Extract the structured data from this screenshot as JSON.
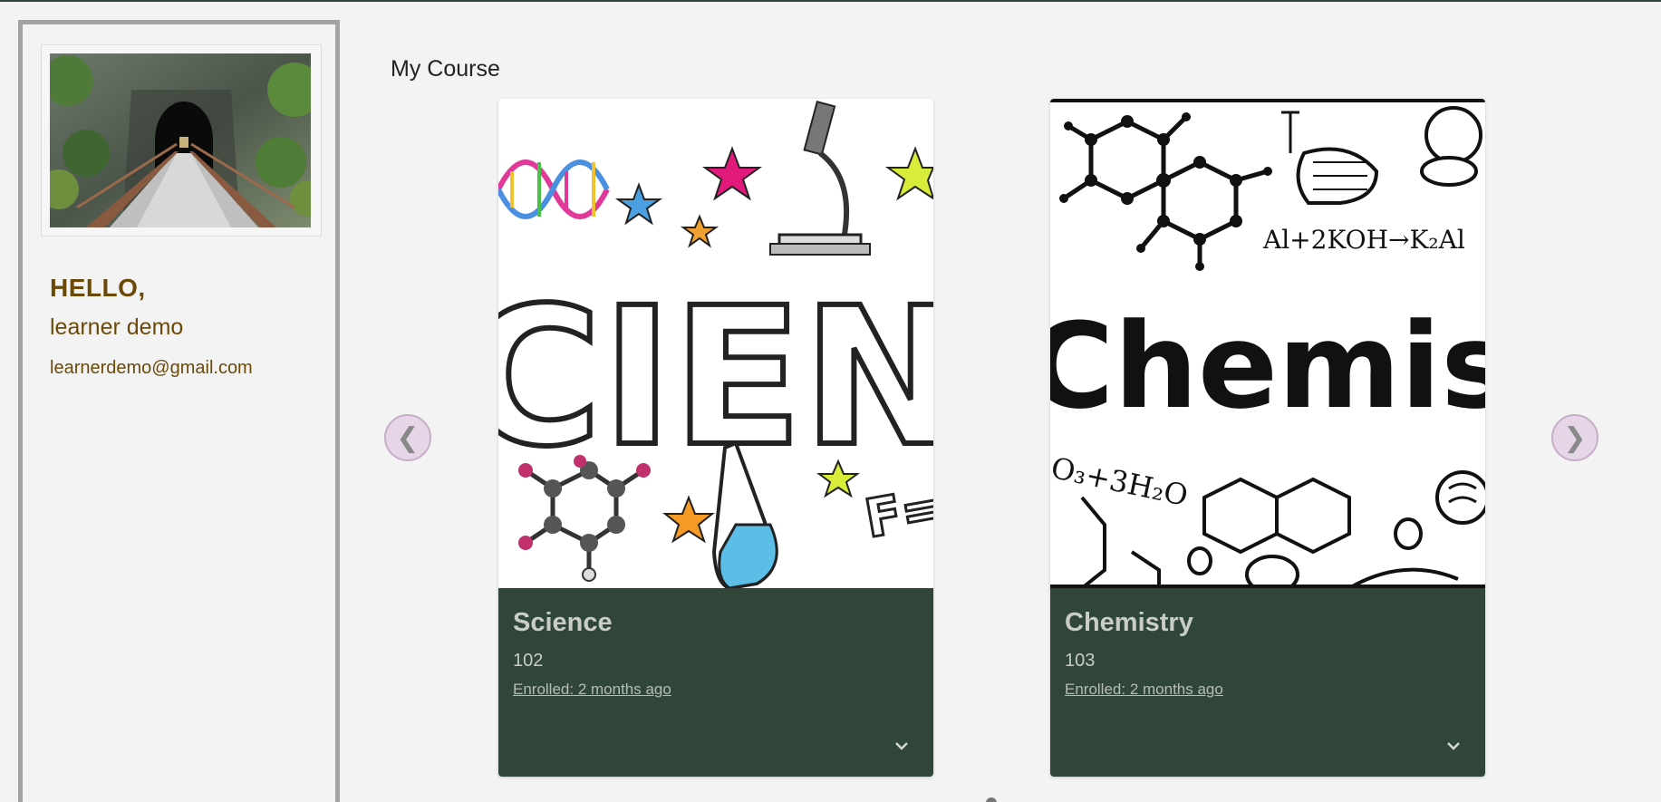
{
  "sidebar": {
    "greeting": "HELLO,",
    "user_name": "learner demo",
    "user_email": "learnerdemo@gmail.com",
    "avatar_icon": "tunnel-bridge-photo"
  },
  "main": {
    "section_title": "My Course",
    "prev_arrow": "❮",
    "next_arrow": "❯",
    "courses": [
      {
        "title": "Science",
        "code": "102",
        "enrolled": "Enrolled: 2 months ago",
        "image_icon": "science-illustration"
      },
      {
        "title": "Chemistry",
        "code": "103",
        "enrolled": "Enrolled: 2 months ago",
        "image_icon": "chemistry-illustration"
      }
    ]
  },
  "colors": {
    "accent_brown": "#6b4a08",
    "card_footer": "#304638",
    "nav_arrow_bg": "#e6d6e8",
    "top_bar": "#2f4a3a"
  }
}
